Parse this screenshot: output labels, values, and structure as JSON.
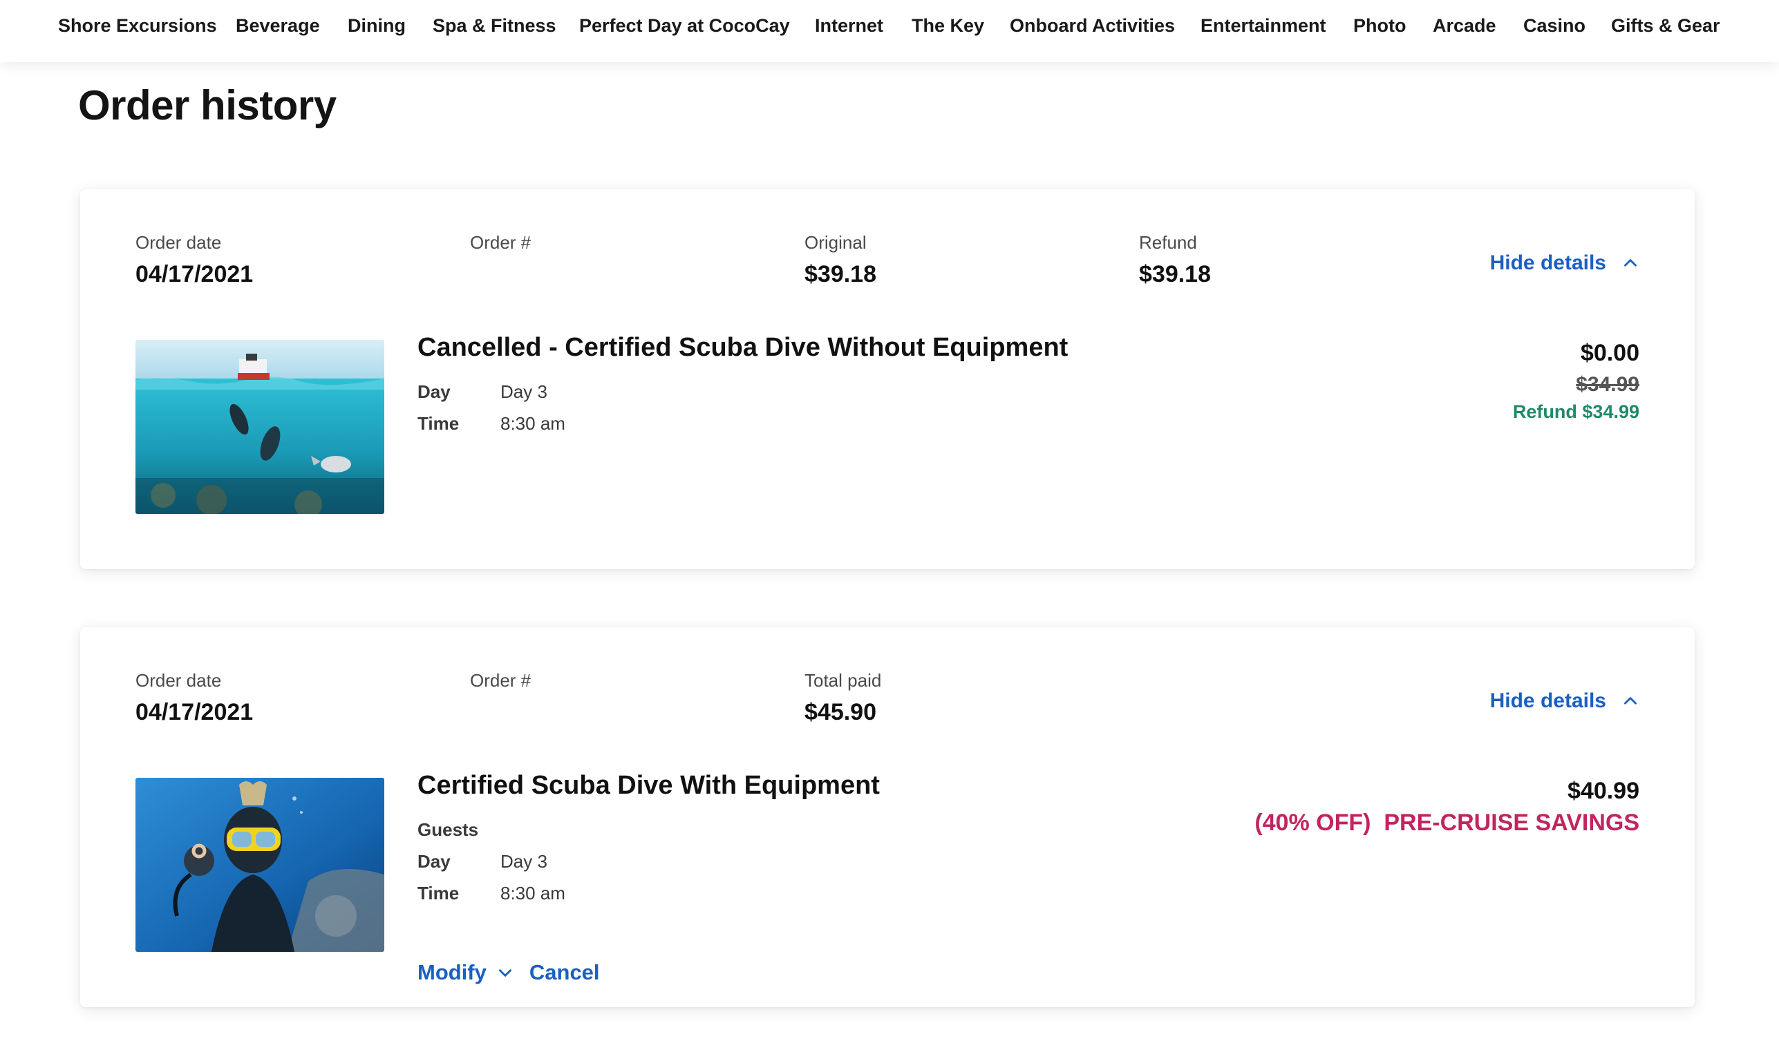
{
  "nav": {
    "items": [
      "Shore Excursions",
      "Beverage",
      "Dining",
      "Spa & Fitness",
      "Perfect Day at CocoCay",
      "Internet",
      "The Key",
      "Onboard Activities",
      "Entertainment",
      "Photo",
      "Arcade",
      "Casino",
      "Gifts & Gear"
    ]
  },
  "page": {
    "title": "Order history"
  },
  "orders": [
    {
      "date_label": "Order date",
      "date": "04/17/2021",
      "number_label": "Order #",
      "amount_label": "Original",
      "amount": "$39.18",
      "refund_label": "Refund",
      "refund": "$39.18",
      "toggle_label": "Hide details",
      "item": {
        "title": "Cancelled - Certified Scuba Dive Without Equipment",
        "day_label": "Day",
        "day": "Day 3",
        "time_label": "Time",
        "time": "8:30 am",
        "price": "$0.00",
        "original_price": "$34.99",
        "refund_text": "Refund $34.99"
      }
    },
    {
      "date_label": "Order date",
      "date": "04/17/2021",
      "number_label": "Order #",
      "amount_label": "Total paid",
      "amount": "$45.90",
      "toggle_label": "Hide details",
      "item": {
        "title": "Certified Scuba Dive With Equipment",
        "guests_label": "Guests",
        "day_label": "Day",
        "day": "Day 3",
        "time_label": "Time",
        "time": "8:30 am",
        "price": "$40.99",
        "discount": "(40% OFF)",
        "savings_label": "PRE-CRUISE SAVINGS",
        "modify_label": "Modify",
        "cancel_label": "Cancel"
      }
    }
  ],
  "colors": {
    "link": "#1a5fc4",
    "refund": "#1f8a68",
    "savings": "#c2245f"
  },
  "icons": [
    "chevron-up-icon",
    "chevron-down-icon"
  ]
}
